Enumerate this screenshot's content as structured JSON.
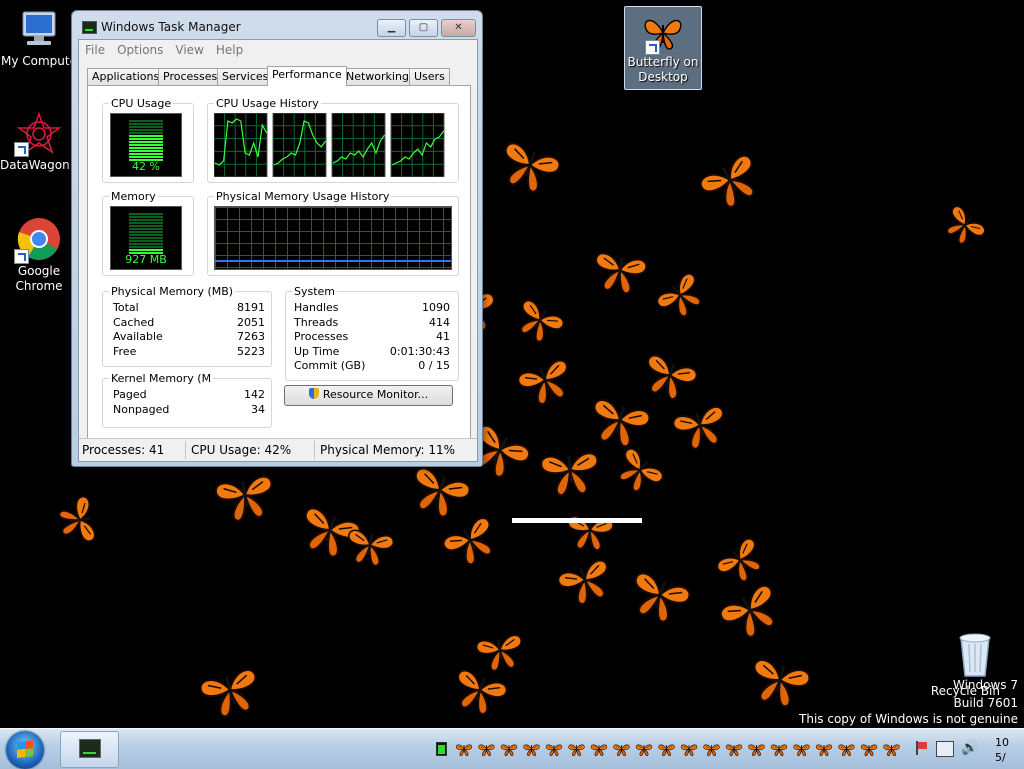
{
  "desktop": {
    "icons": [
      {
        "label": "My Compute",
        "icon": "computer-icon"
      },
      {
        "label": "DataWagon...",
        "icon": "datawagon-icon"
      },
      {
        "label": "Google Chrome",
        "icon": "chrome-icon"
      },
      {
        "label": "Butterfly on Desktop",
        "icon": "butterfly-icon"
      }
    ],
    "recycle_bin_label": "Recycle Bin",
    "watermark": [
      "Windows 7",
      "Build 7601",
      "This copy of Windows is not genuine"
    ]
  },
  "task_manager": {
    "title": "Windows Task Manager",
    "menu": [
      "File",
      "Options",
      "View",
      "Help"
    ],
    "tabs": [
      "Applications",
      "Processes",
      "Services",
      "Performance",
      "Networking",
      "Users"
    ],
    "active_tab": "Performance",
    "cpu_usage": {
      "label": "CPU Usage",
      "value_text": "42 %",
      "level": 0.42
    },
    "cpu_history_label": "CPU Usage History",
    "memory": {
      "label": "Memory",
      "value_text": "927 MB",
      "level": 0.11
    },
    "memory_history_label": "Physical Memory Usage History",
    "physical_memory": {
      "label": "Physical Memory (MB)",
      "rows": [
        {
          "label": "Total",
          "value": "8191"
        },
        {
          "label": "Cached",
          "value": "2051"
        },
        {
          "label": "Available",
          "value": "7263"
        },
        {
          "label": "Free",
          "value": "5223"
        }
      ]
    },
    "kernel_memory": {
      "label": "Kernel Memory (M",
      "rows": [
        {
          "label": "Paged",
          "value": "142"
        },
        {
          "label": "Nonpaged",
          "value": "34"
        }
      ]
    },
    "system": {
      "label": "System",
      "rows": [
        {
          "label": "Handles",
          "value": "1090"
        },
        {
          "label": "Threads",
          "value": "414"
        },
        {
          "label": "Processes",
          "value": "41"
        },
        {
          "label": "Up Time",
          "value": "0:01:30:43"
        },
        {
          "label": "Commit (GB)",
          "value": "0 / 15"
        }
      ]
    },
    "resource_monitor_button": "Resource Monitor...",
    "status": {
      "processes": "Processes: 41",
      "cpu": "CPU Usage: 42%",
      "memory": "Physical Memory: 11%"
    }
  },
  "taskbar": {
    "clock": [
      "10",
      "5/"
    ],
    "tray_butterfly_count": 20
  },
  "colors": {
    "graph_green": "#39ff39",
    "grid_green": "#0d6b32",
    "butterfly_orange": "#f07a10"
  }
}
